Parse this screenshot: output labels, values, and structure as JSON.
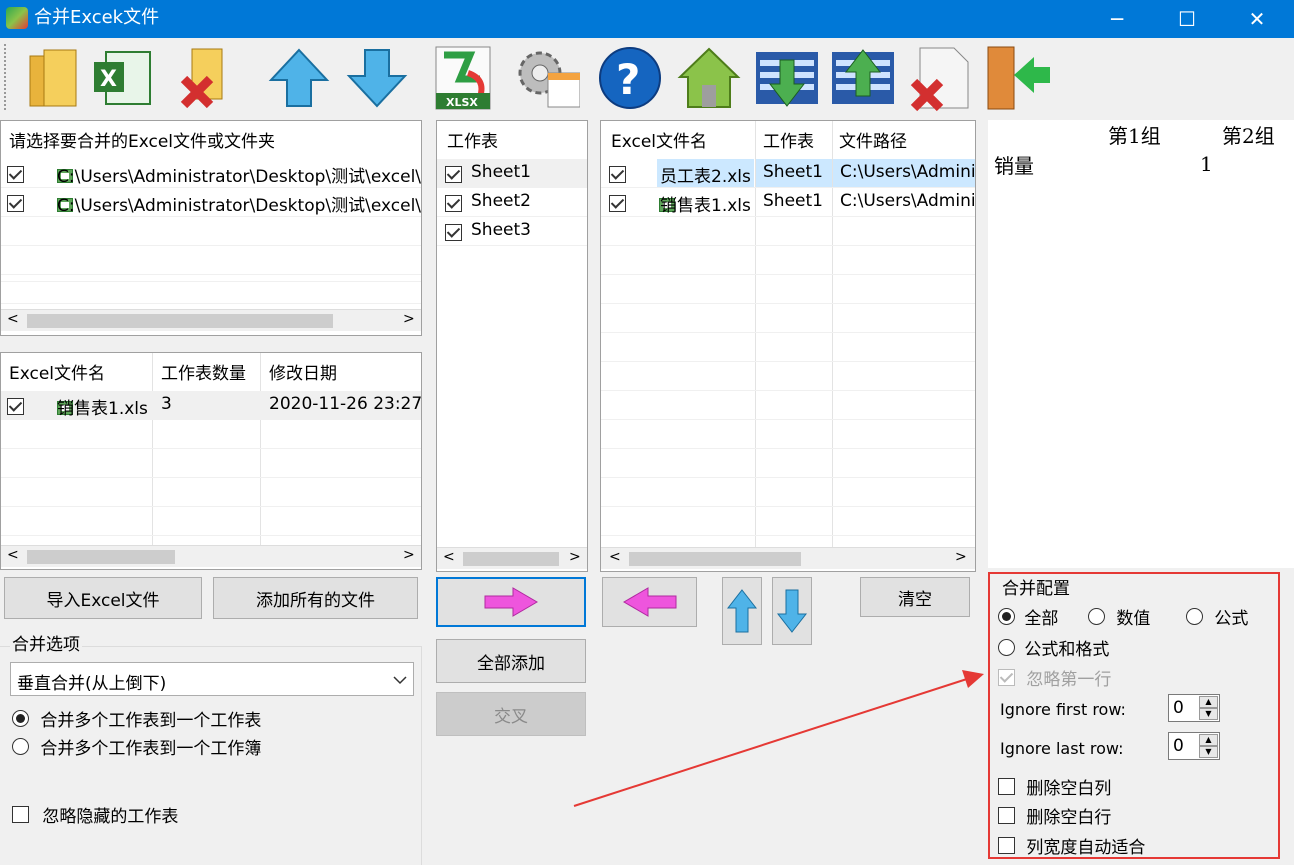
{
  "window": {
    "title": "合并Excek文件",
    "minimize": "─",
    "maximize": "☐",
    "close": "✕"
  },
  "toolbar": {
    "items": [
      "open-folder-icon",
      "excel-file-icon",
      "remove-folder-icon",
      "move-up-icon",
      "move-down-icon",
      "xlsx-export-icon",
      "settings-icon",
      "help-icon",
      "home-icon",
      "import-list-icon",
      "export-list-icon",
      "delete-file-icon",
      "exit-door-icon"
    ],
    "xlsx_text": "XLSX"
  },
  "source": {
    "header": "请选择要合并的Excel文件或文件夹",
    "paths": [
      "C:\\Users\\Administrator\\Desktop\\测试\\excel\\员",
      "C:\\Users\\Administrator\\Desktop\\测试\\excel\\销"
    ]
  },
  "files": {
    "columns": [
      "Excel文件名",
      "工作表数量",
      "修改日期"
    ],
    "rows": [
      {
        "name": "销售表1.xls",
        "count": "3",
        "date": "2020-11-26 23:27:"
      }
    ]
  },
  "sheets": {
    "header": "工作表",
    "items": [
      "Sheet1",
      "Sheet2",
      "Sheet3"
    ]
  },
  "selected": {
    "columns": [
      "Excel文件名",
      "工作表",
      "文件路径"
    ],
    "rows": [
      {
        "file": "员工表2.xls",
        "sheet": "Sheet1",
        "path": "C:\\Users\\Admini"
      },
      {
        "file": "销售表1.xls",
        "sheet": "Sheet1",
        "path": "C:\\Users\\Admini"
      }
    ]
  },
  "preview": {
    "col1": "第1组",
    "col2": "第2组",
    "row_label": "销量",
    "row_value": "1"
  },
  "buttons": {
    "import": "导入Excel文件",
    "add_all_files": "添加所有的文件",
    "add_all": "全部添加",
    "cross": "交叉",
    "clear": "清空"
  },
  "merge_options": {
    "title": "合并选项",
    "mode": "垂直合并(从上倒下)",
    "radio1": "合并多个工作表到一个工作表",
    "radio2": "合并多个工作表到一个工作簿",
    "ignore_hidden": "忽略隐藏的工作表"
  },
  "config": {
    "title": "合并配置",
    "opt_all": "全部",
    "opt_value": "数值",
    "opt_formula": "公式",
    "opt_formula_format": "公式和格式",
    "ignore_first_line": "忽略第一行",
    "ignore_first_row_label": "Ignore first row:",
    "ignore_first_row_value": "0",
    "ignore_last_row_label": "Ignore last row:",
    "ignore_last_row_value": "0",
    "delete_blank_cols": "删除空白列",
    "delete_blank_rows": "删除空白行",
    "autofit": "列宽度自动适合"
  },
  "colors": {
    "titlebar": "#0078d7",
    "highlight": "#cce8ff",
    "annotation": "#e53935",
    "arrow_pink": "#ee55dd"
  }
}
